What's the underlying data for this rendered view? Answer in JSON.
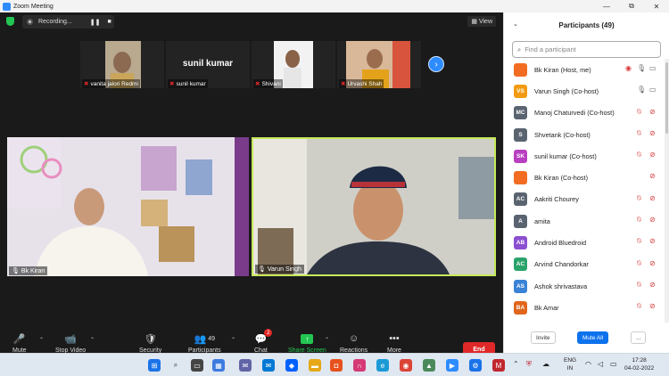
{
  "window": {
    "title": "Zoom Meeting",
    "minimize": "—",
    "restore": "⧉",
    "close": "✕"
  },
  "topbar": {
    "recording_label": "Recording...",
    "pause": "❚❚",
    "stop": "■",
    "view_label": "View"
  },
  "gallery": {
    "tiles": [
      {
        "name": "vanita jalori Redmi"
      },
      {
        "name": "sunil kumar",
        "display": "sunil kumar"
      },
      {
        "name": "Shivani"
      },
      {
        "name": "Urvashi Shah"
      }
    ],
    "next": "›"
  },
  "main_videos": [
    {
      "name": "Bk Kiran"
    },
    {
      "name": "Varun Singh"
    }
  ],
  "toolbar": {
    "mute": "Mute",
    "stop_video": "Stop Video",
    "security": "Security",
    "participants": "Participants",
    "participants_count": "49",
    "chat": "Chat",
    "chat_badge": "2",
    "share_screen": "Share Screen",
    "reactions": "Reactions",
    "more": "More",
    "end": "End"
  },
  "panel": {
    "title": "Participants (49)",
    "search_placeholder": "Find a participant",
    "participants": [
      {
        "initials": "",
        "name": "Bk Kiran (Host, me)",
        "color": "#f26d21",
        "mic": "on",
        "video": "on",
        "rec": true
      },
      {
        "initials": "VS",
        "name": "Varun Singh (Co-host)",
        "color": "#f29b11",
        "mic": "on",
        "video": "on",
        "rec": false
      },
      {
        "initials": "MC",
        "name": "Manoj Chaturvedi (Co-host)",
        "color": "#5a6470",
        "mic": "off",
        "video": "off",
        "rec": false
      },
      {
        "initials": "S",
        "name": "Shvetank (Co-host)",
        "color": "#5a6470",
        "mic": "off",
        "video": "off",
        "rec": false
      },
      {
        "initials": "SK",
        "name": "sunil kumar (Co-host)",
        "color": "#b83fc0",
        "mic": "off",
        "video": "off",
        "rec": false
      },
      {
        "initials": "",
        "name": "Bk Kiran (Co-host)",
        "color": "#f26d21",
        "mic": "none",
        "video": "off",
        "rec": false
      },
      {
        "initials": "AC",
        "name": "Aakriti Chourey",
        "color": "#5a6470",
        "mic": "off",
        "video": "off",
        "rec": false
      },
      {
        "initials": "A",
        "name": "amita",
        "color": "#5a6470",
        "mic": "off",
        "video": "off",
        "rec": false
      },
      {
        "initials": "AB",
        "name": "Android Bluedroid",
        "color": "#8b4fd0",
        "mic": "off",
        "video": "off",
        "rec": false
      },
      {
        "initials": "AC",
        "name": "Arvind Chandorkar",
        "color": "#2aa36a",
        "mic": "off",
        "video": "off",
        "rec": false
      },
      {
        "initials": "AS",
        "name": "Ashok shrivastava",
        "color": "#3a82d6",
        "mic": "off",
        "video": "off",
        "rec": false
      },
      {
        "initials": "BA",
        "name": "Bk Amar",
        "color": "#e0661c",
        "mic": "off",
        "video": "off",
        "rec": false
      }
    ],
    "invite": "Invite",
    "mute_all": "Mute All",
    "more": "..."
  },
  "taskbar": {
    "lang_top": "ENG",
    "lang_bottom": "IN",
    "time": "17:28",
    "date": "04-02-2022"
  }
}
